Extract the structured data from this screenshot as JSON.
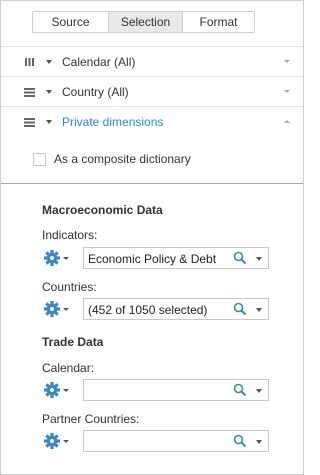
{
  "tabs": [
    {
      "label": "Source",
      "active": false
    },
    {
      "label": "Selection",
      "active": true
    },
    {
      "label": "Format",
      "active": false
    }
  ],
  "dimensions": [
    {
      "label": "Calendar (All)",
      "handle": "columns-icon",
      "expanded": false
    },
    {
      "label": "Country (All)",
      "handle": "rows-icon",
      "expanded": false
    },
    {
      "label": "Private dimensions",
      "handle": "rows-icon",
      "expanded": true,
      "link": true
    }
  ],
  "composite": {
    "label": "As a composite dictionary",
    "checked": false
  },
  "sections": [
    {
      "title": "Macroeconomic Data",
      "fields": [
        {
          "label": "Indicators:",
          "value": "Economic Policy & Debt"
        },
        {
          "label": "Countries:",
          "value": "(452 of 1050 selected)"
        }
      ]
    },
    {
      "title": "Trade Data",
      "fields": [
        {
          "label": "Calendar:",
          "value": ""
        },
        {
          "label": "Partner Countries:",
          "value": ""
        }
      ]
    }
  ],
  "colors": {
    "accent": "#2a8ccd",
    "gear": "#3a86c8",
    "active_tab": "#e8e8e8"
  }
}
